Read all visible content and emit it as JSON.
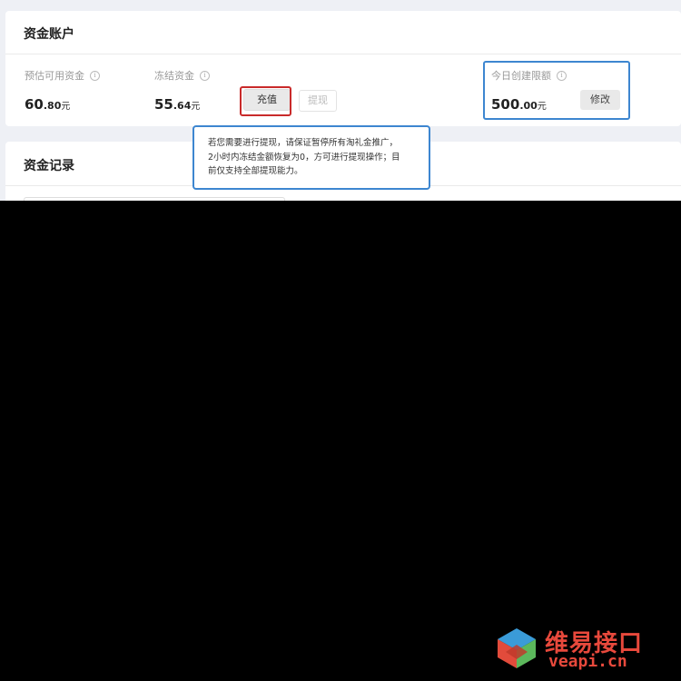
{
  "account": {
    "title": "资金账户",
    "estimated": {
      "label": "预估可用资金",
      "int": "60",
      "dec": ".80",
      "unit": "元"
    },
    "frozen": {
      "label": "冻结资金",
      "int": "55",
      "dec": ".64",
      "unit": "元"
    },
    "recharge_label": "充值",
    "withdraw_label": "提现",
    "daily_limit": {
      "label": "今日创建限额",
      "int": "500",
      "dec": ".00",
      "unit": "元",
      "modify_label": "修改"
    }
  },
  "tooltip": {
    "line1": "若您需要进行提现，请保证暂停所有淘礼金推广，",
    "line2": "2小时内冻结金额恢复为0，方可进行提现操作；目",
    "line3": "前仅支持全部提现能力。"
  },
  "records": {
    "title": "资金记录"
  },
  "watermark": {
    "title": "维易接口",
    "url": "veapi.cn"
  },
  "colors": {
    "highlight_red": "#c92a2a",
    "highlight_blue": "#3d86d0",
    "watermark": "#e8493c"
  },
  "icons": {
    "info": "info-circle-icon"
  }
}
